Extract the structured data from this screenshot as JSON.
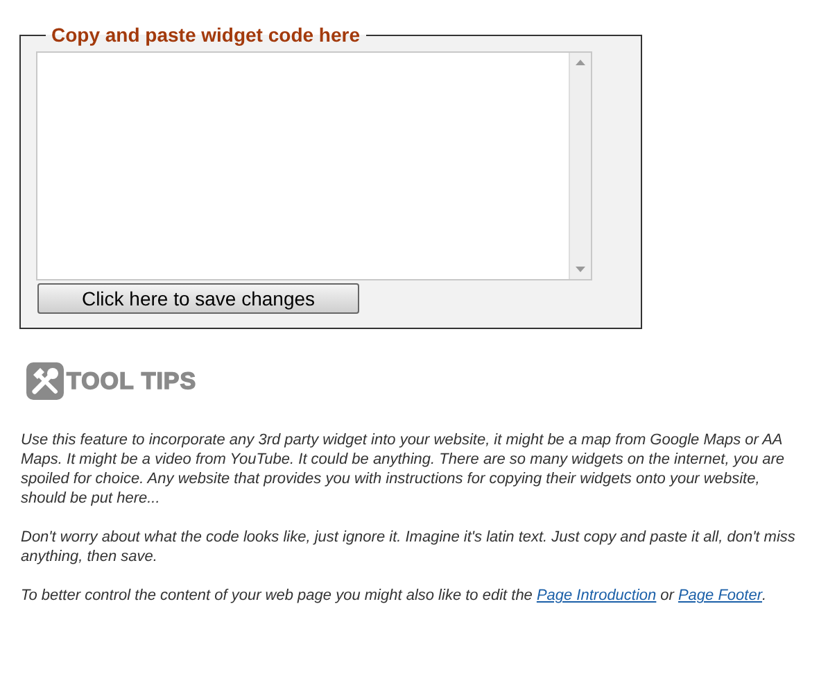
{
  "widget_panel": {
    "legend": "Copy and paste widget code here",
    "save_button": "Click here to save changes"
  },
  "tool_tips": {
    "heading": "TOOL TIPS",
    "paragraphs": [
      {
        "text": "Use this feature to incorporate any 3rd party widget into your website, it might be a map from Google Maps or AA Maps. It might be a video from YouTube. It could be anything. There are so many widgets on the internet, you are spoiled for choice. Any website that provides you with instructions for copying their widgets onto your website, should be put here..."
      },
      {
        "text": "Don't worry about what the code looks like, just ignore it. Imagine it's latin text. Just copy and paste it all, don't miss anything, then save."
      }
    ],
    "links_sentence": {
      "before": "To better control the content of your web page you might also like to edit the",
      "links": [
        "Page Introduction",
        "Page Footer"
      ],
      "between": "or",
      "after": "."
    }
  }
}
